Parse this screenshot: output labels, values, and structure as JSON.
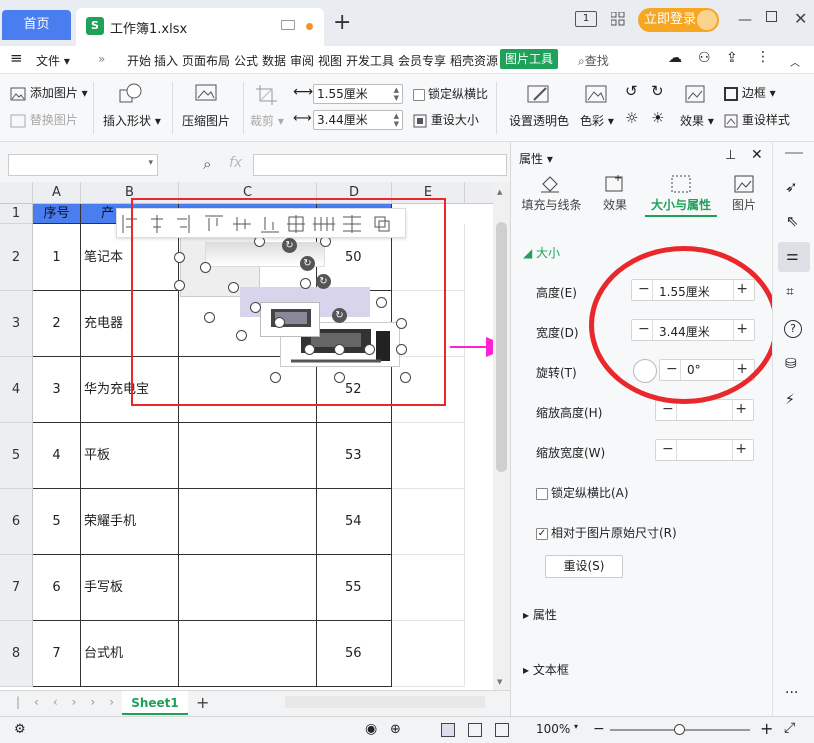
{
  "tabs": {
    "home": "首页",
    "file_name": "工作簿1.xlsx",
    "file_icon": "S"
  },
  "login": {
    "label": "立即登录"
  },
  "menu": {
    "file_label": "文件",
    "items": [
      "开始",
      "插入",
      "页面布局",
      "公式",
      "数据",
      "审阅",
      "视图",
      "开发工具",
      "会员专享",
      "稻壳资源"
    ],
    "picture_tool": "图片工具",
    "search": "查找"
  },
  "ribbon": {
    "add_picture": "添加图片",
    "replace_picture": "替换图片",
    "insert_shape": "插入形状",
    "compress": "压缩图片",
    "crop": "裁剪",
    "height": "1.55厘米",
    "width": "3.44厘米",
    "lock_ratio": "锁定纵横比",
    "reset_size": "重设大小",
    "set_transparent": "设置透明色",
    "color": "色彩",
    "effect": "效果",
    "border": "边框",
    "reset_style": "重设样式"
  },
  "sheet": {
    "columns": [
      "A",
      "B",
      "C",
      "D",
      "E"
    ],
    "rows": [
      "1",
      "2",
      "3",
      "4",
      "5",
      "6",
      "7",
      "8"
    ],
    "header": {
      "no": "序号",
      "name": "产"
    },
    "data": [
      {
        "no": "1",
        "name": "笔记本",
        "value": "50"
      },
      {
        "no": "2",
        "name": "充电器",
        "value": ""
      },
      {
        "no": "3",
        "name": "华为充电宝",
        "value": "52"
      },
      {
        "no": "4",
        "name": "平板",
        "value": "53"
      },
      {
        "no": "5",
        "name": "荣耀手机",
        "value": "54"
      },
      {
        "no": "6",
        "name": "手写板",
        "value": "55"
      },
      {
        "no": "7",
        "name": "台式机",
        "value": "56"
      }
    ],
    "tab": "Sheet1"
  },
  "panel": {
    "title": "属性",
    "tabs": [
      "填充与线条",
      "效果",
      "大小与属性",
      "图片"
    ],
    "section_size": "大小",
    "height_label": "高度(E)",
    "height_value": "1.55厘米",
    "width_label": "宽度(D)",
    "width_value": "3.44厘米",
    "rotation_label": "旋转(T)",
    "rotation_value": "0°",
    "scale_h_label": "缩放高度(H)",
    "scale_w_label": "缩放宽度(W)",
    "lock_label": "锁定纵横比(A)",
    "relative_label": "相对于图片原始尺寸(R)",
    "reset_label": "重设(S)",
    "section_props": "属性",
    "section_textbox": "文本框"
  },
  "status": {
    "zoom": "100%"
  },
  "colors": {
    "accent": "#1fa15a",
    "home_tab": "#4a7ef0",
    "annotation": "#e8282b",
    "arrow": "#ff22d4",
    "login": "#f5a623"
  }
}
